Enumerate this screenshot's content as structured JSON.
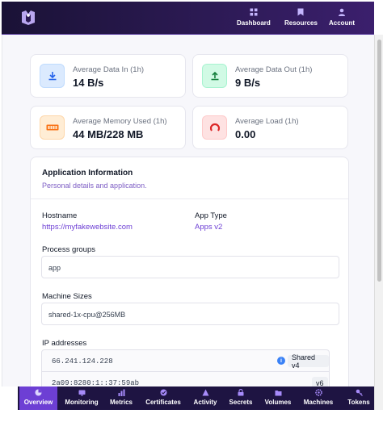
{
  "header": {
    "nav": [
      {
        "label": "Dashboard",
        "icon": "grid-icon"
      },
      {
        "label": "Resources",
        "icon": "bookmark-icon"
      },
      {
        "label": "Account",
        "icon": "user-icon"
      }
    ]
  },
  "stats": [
    {
      "label": "Average Data In (1h)",
      "value": "14 B/s",
      "icon": "download-icon",
      "color": "#3b82f6",
      "bg": "#dbeafe"
    },
    {
      "label": "Average Data Out (1h)",
      "value": "9 B/s",
      "icon": "upload-icon",
      "color": "#16a34a",
      "bg": "#d1fae5"
    },
    {
      "label": "Average Memory Used (1h)",
      "value": "44 MB/228 MB",
      "icon": "memory-icon",
      "color": "#f97316",
      "bg": "#ffedd5"
    },
    {
      "label": "Average Load (1h)",
      "value": "0.00",
      "icon": "gauge-icon",
      "color": "#dc2626",
      "bg": "#fee2e2"
    }
  ],
  "info": {
    "title": "Application Information",
    "subtitle": "Personal details and application.",
    "hostname_label": "Hostname",
    "hostname_value": "https://myfakewebsite.com",
    "apptype_label": "App Type",
    "apptype_value": "Apps v2",
    "process_label": "Process groups",
    "process_value": "app",
    "machine_label": "Machine Sizes",
    "machine_value": "shared-1x-cpu@256MB",
    "ip_label": "IP addresses",
    "ips": [
      {
        "address": "66.241.124.228",
        "badge": "Shared v4"
      },
      {
        "address": "2a09:8280:1::37:59ab",
        "badge": "v6"
      }
    ]
  },
  "tabs": [
    {
      "label": "Overview",
      "icon": "pie-icon",
      "active": true
    },
    {
      "label": "Monitoring",
      "icon": "monitor-icon",
      "active": false
    },
    {
      "label": "Metrics",
      "icon": "bars-icon",
      "active": false
    },
    {
      "label": "Certificates",
      "icon": "badge-icon",
      "active": false
    },
    {
      "label": "Activity",
      "icon": "activity-icon",
      "active": false
    },
    {
      "label": "Secrets",
      "icon": "lock-icon",
      "active": false
    },
    {
      "label": "Volumes",
      "icon": "folder-icon",
      "active": false
    },
    {
      "label": "Machines",
      "icon": "cog-icon",
      "active": false
    },
    {
      "label": "Tokens",
      "icon": "key-icon",
      "active": false
    }
  ]
}
